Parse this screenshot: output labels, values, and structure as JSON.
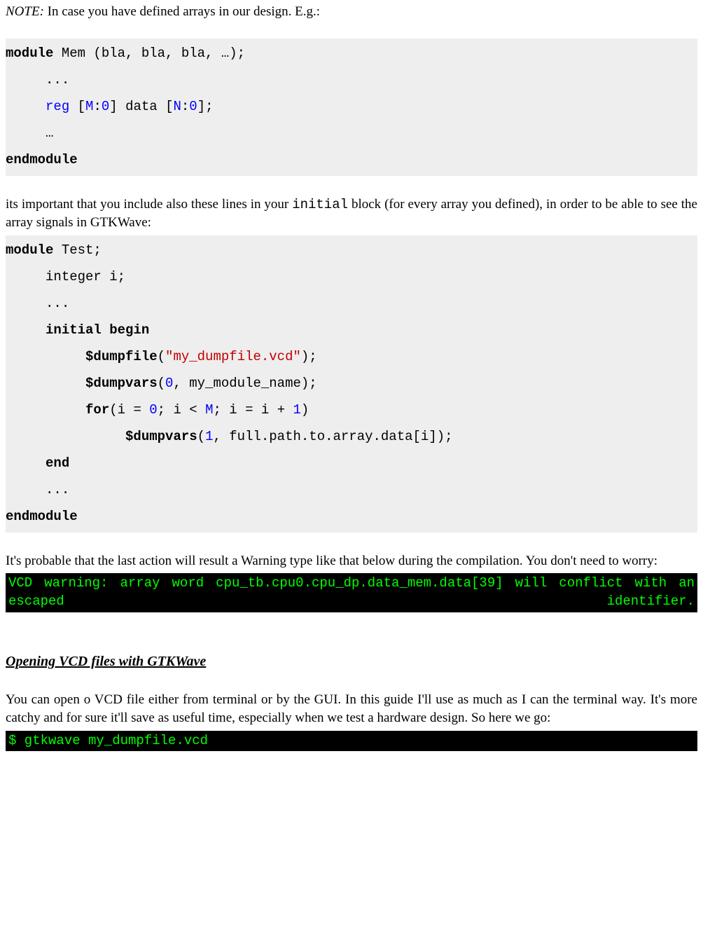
{
  "note": {
    "label": "NOTE:",
    "text": " In case you have defined arrays in our design. E.g.:"
  },
  "code1": {
    "l1a": "module",
    "l1b": " Mem (bla, bla, bla, …);",
    "l2": "     ...",
    "l3a": "     ",
    "l3_reg": "reg",
    "l3b": " [",
    "l3_M": "M",
    "l3c": ":",
    "l3_z1": "0",
    "l3d": "] data [",
    "l3_N": "N",
    "l3e": ":",
    "l3_z2": "0",
    "l3f": "];",
    "l4": "     …",
    "l5": "endmodule"
  },
  "para1": {
    "a": "its important that you include also these lines in your ",
    "b": "initial",
    "c": " block (for every array you defined), in order to be able to see the array signals in GTKWave:"
  },
  "code2": {
    "l1a": "module",
    "l1b": " Test;",
    "l2": "     integer i;",
    "l3": "     ...",
    "l4": "     initial begin",
    "l5a": "          $dumpfile",
    "l5b": "(",
    "l5c": "\"my_dumpfile.vcd\"",
    "l5d": ");",
    "l6a": "          $dumpvars",
    "l6b": "(",
    "l6_z": "0",
    "l6c": ", my_module_name);",
    "l7a": "          for",
    "l7b": "(i = ",
    "l7_z": "0",
    "l7c": "; i < ",
    "l7_M": "M",
    "l7d": "; i = i + ",
    "l7_one": "1",
    "l7e": ")",
    "l8a": "               $dumpvars",
    "l8b": "(",
    "l8_one": "1",
    "l8c": ", full.path.to.array.data[i]);",
    "l9": "     end",
    "l10": "     ...",
    "l11": "endmodule"
  },
  "para2": "It's probable that the last action will result a Warning type like that below during the compilation. You don't need to worry:",
  "term1": "VCD warning: array word cpu_tb.cpu0.cpu_dp.data_mem.data[39] will conflict with an escaped identifier.",
  "heading": "Opening VCD files with GTKWave",
  "para3": "You can open o VCD file either from terminal or by the GUI. In this guide I'll use as much as I can the terminal way. It's more catchy and for sure it'll save as useful time, especially when we test a hardware design. So here we go:",
  "term2": " $ gtkwave my_dumpfile.vcd"
}
